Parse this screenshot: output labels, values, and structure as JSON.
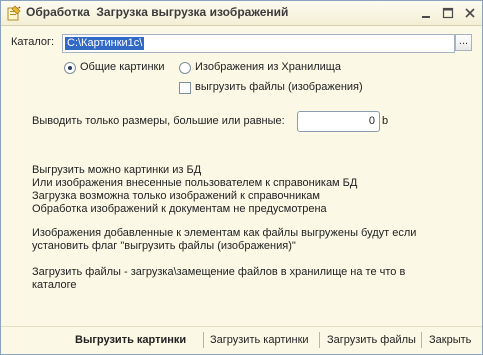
{
  "window": {
    "title": "Обработка  Загрузка выгрузка изображений",
    "icons": [
      "form-icon",
      "minimize-icon",
      "maximize-icon",
      "close-icon"
    ]
  },
  "catalog": {
    "label": "Каталог:",
    "value": "C:\\Картинки1с\\",
    "browse_label": "..."
  },
  "options": {
    "radio_general": "Общие картинки",
    "radio_storage": "Изображения из Хранилища",
    "radio_selected": "general",
    "checkbox_label": "выгрузить файлы (изображения)",
    "checkbox_checked": false
  },
  "size_filter": {
    "label": "Выводить только размеры, большие или равные:",
    "value": "0",
    "unit": "b"
  },
  "info": {
    "line1": "Выгрузить можно картинки из БД",
    "line2": "Или изображения внесенные пользователем к справоникам БД",
    "line3": "Загрузка возможна только изображений к справочникам",
    "line4": "Обработка изображений к документам не предусмотрена",
    "line5": "Изображения добавленные к элементам как файлы выгружены будут если",
    "line6": "установить флаг \"выгрузить файлы (изображения)\"",
    "line7": "Загрузить файлы - загрузка\\замещение файлов в хранилище на те что в",
    "line8": "каталоге"
  },
  "buttons": {
    "export_images": "Выгрузить картинки",
    "import_images": "Загрузить картинки",
    "import_files": "Загрузить файлы",
    "close": "Закрыть"
  },
  "colors": {
    "background": "#fbf8e6",
    "selection": "#3169c6",
    "border": "#8aa3c0"
  }
}
